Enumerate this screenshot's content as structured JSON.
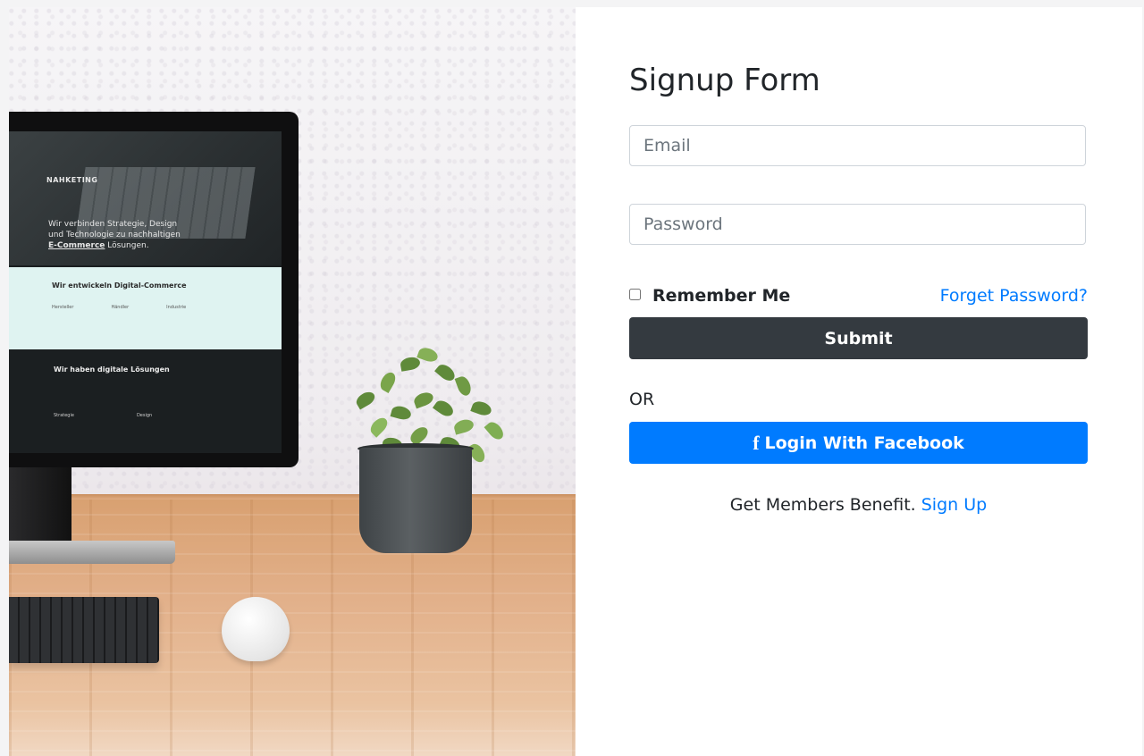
{
  "photo": {
    "alt_label": "",
    "screen": {
      "brand": "NAHKETING",
      "hero_line1": "Wir verbinden Strategie, Design",
      "hero_line2": "und Technologie zu nachhaltigen",
      "hero_strong": "E-Commerce",
      "hero_tail": " Lösungen.",
      "band_title": "Wir entwickeln Digital-Commerce",
      "band_cols": [
        "Hersteller",
        "Händler",
        "Industrie"
      ],
      "dark_title": "Wir haben digitale Lösungen",
      "dark_cols": [
        "Strategie",
        "Design"
      ]
    }
  },
  "form": {
    "title": "Signup Form",
    "email_placeholder": "Email",
    "password_placeholder": "Password",
    "remember_label": "Remember Me",
    "forget_label": "Forget Password?",
    "submit_label": "Submit",
    "or_label": "OR",
    "facebook_icon": "f",
    "facebook_label": "Login With Facebook",
    "members_text": "Get Members Benefit.",
    "signup_label": "Sign Up"
  },
  "colors": {
    "primary": "#007bff",
    "dark": "#343a40"
  }
}
